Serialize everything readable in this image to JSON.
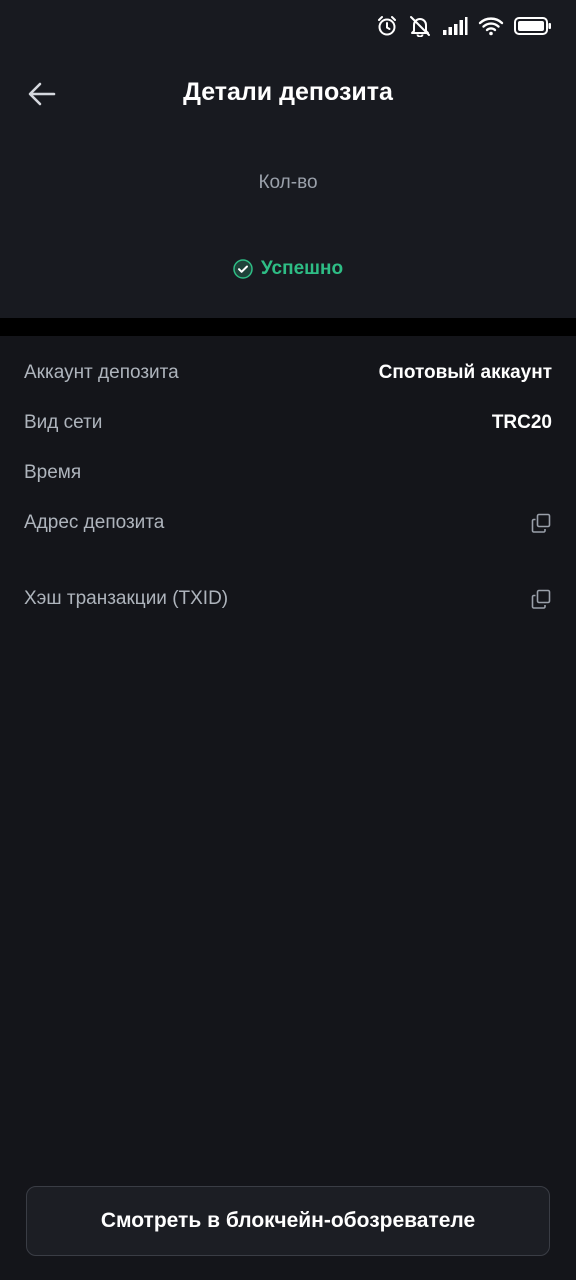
{
  "status_bar": {
    "icons": [
      "alarm-icon",
      "mute-icon",
      "signal-icon",
      "wifi-icon",
      "battery-icon"
    ]
  },
  "header": {
    "title": "Детали депозита",
    "amount_label": "Кол-во",
    "status": "Успешно",
    "status_color": "#2ebd85"
  },
  "details": {
    "deposit_account_label": "Аккаунт депозита",
    "deposit_account_value": "Спотовый аккаунт",
    "network_label": "Вид сети",
    "network_value": "TRC20",
    "time_label": "Время",
    "address_label": "Адрес депозита",
    "txid_label": "Хэш транзакции (TXID)"
  },
  "footer": {
    "explorer_button": "Смотреть в блокчейн-обозревателе"
  }
}
